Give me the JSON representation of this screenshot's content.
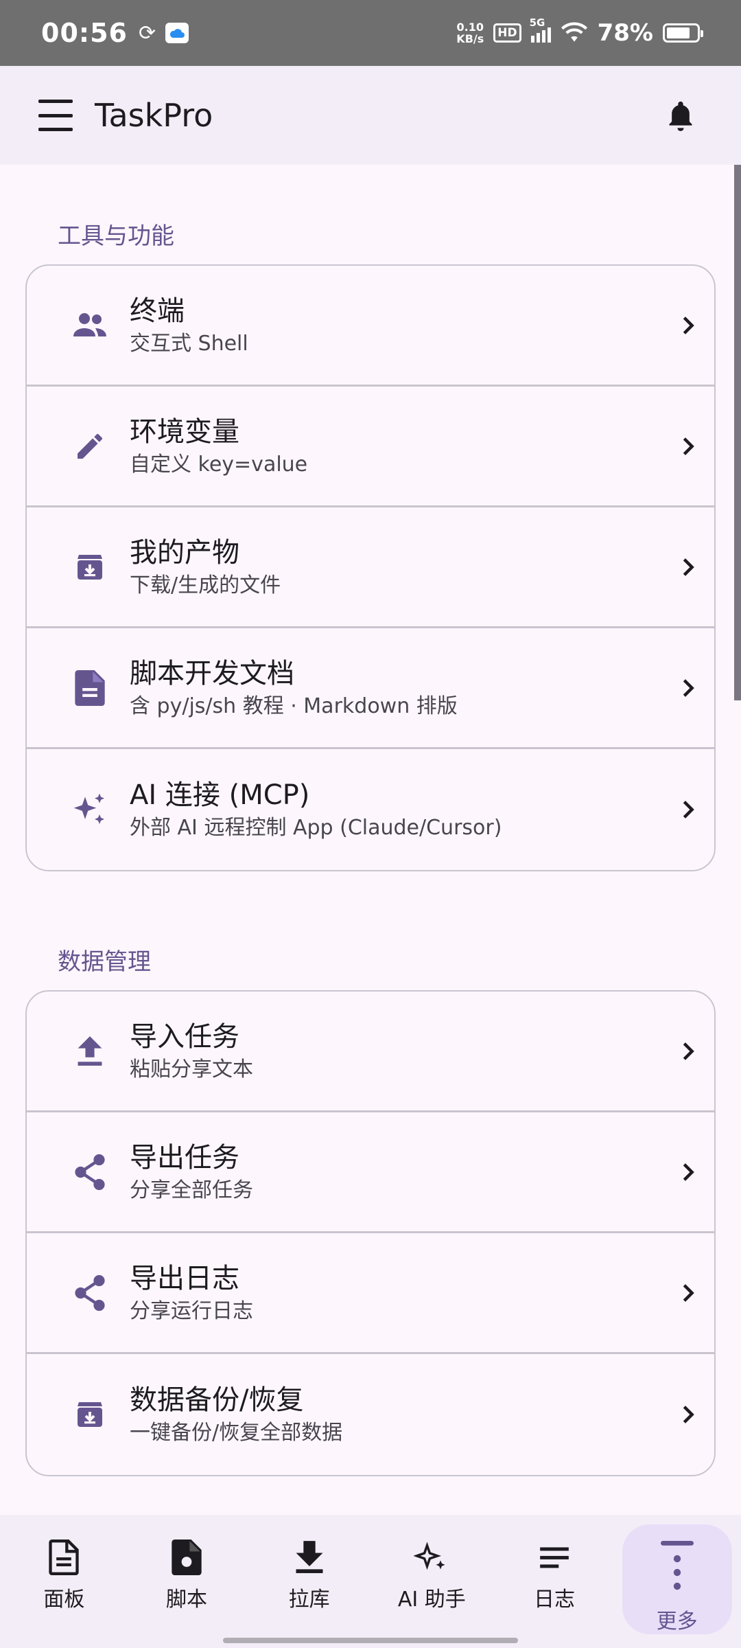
{
  "status_bar": {
    "time": "00:56",
    "net_speed_value": "0.10",
    "net_speed_unit": "KB/s",
    "hd": "HD",
    "network": "5G",
    "battery": "78%"
  },
  "app_bar": {
    "title": "TaskPro"
  },
  "sections": [
    {
      "title": "工具与功能",
      "items": [
        {
          "label": "终端",
          "sub": "交互式 Shell",
          "icon": "people-icon"
        },
        {
          "label": "环境变量",
          "sub": "自定义 key=value",
          "icon": "pencil-icon"
        },
        {
          "label": "我的产物",
          "sub": "下载/生成的文件",
          "icon": "archive-icon"
        },
        {
          "label": "脚本开发文档",
          "sub": "含 py/js/sh 教程 · Markdown 排版",
          "icon": "document-icon"
        },
        {
          "label": "AI 连接 (MCP)",
          "sub": "外部 AI 远程控制 App (Claude/Cursor)",
          "icon": "sparkle-icon"
        }
      ]
    },
    {
      "title": "数据管理",
      "items": [
        {
          "label": "导入任务",
          "sub": "粘贴分享文本",
          "icon": "upload-icon"
        },
        {
          "label": "导出任务",
          "sub": "分享全部任务",
          "icon": "share-icon"
        },
        {
          "label": "导出日志",
          "sub": "分享运行日志",
          "icon": "share-icon"
        },
        {
          "label": "数据备份/恢复",
          "sub": "一键备份/恢复全部数据",
          "icon": "archive-icon"
        }
      ]
    }
  ],
  "bottom_nav": [
    {
      "label": "面板",
      "icon": "document-icon",
      "active": false
    },
    {
      "label": "脚本",
      "icon": "script-file-icon",
      "active": false
    },
    {
      "label": "拉库",
      "icon": "download-icon",
      "active": false
    },
    {
      "label": "AI 助手",
      "icon": "sparkle-icon",
      "active": false
    },
    {
      "label": "日志",
      "icon": "list-icon",
      "active": false
    },
    {
      "label": "更多",
      "icon": "more-vertical-icon",
      "active": true
    }
  ],
  "colors": {
    "accent": "#65558f",
    "icon": "#65558f",
    "surface": "#fdf7fd",
    "app_bar": "#f3edf7",
    "active_pill": "#e8def8",
    "status_bar": "#6f6f6f"
  }
}
